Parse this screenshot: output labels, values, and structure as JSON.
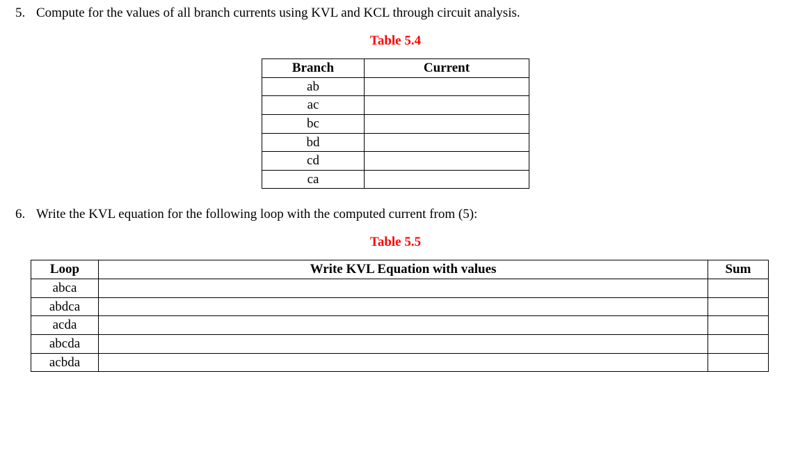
{
  "q5": {
    "number": "5.",
    "text": "Compute for the values of all branch currents using KVL and KCL through circuit analysis.",
    "caption": "Table 5.4",
    "headers": {
      "branch": "Branch",
      "current": "Current"
    },
    "rows": [
      {
        "branch": "ab",
        "current": ""
      },
      {
        "branch": "ac",
        "current": ""
      },
      {
        "branch": "bc",
        "current": ""
      },
      {
        "branch": "bd",
        "current": ""
      },
      {
        "branch": "cd",
        "current": ""
      },
      {
        "branch": "ca",
        "current": ""
      }
    ]
  },
  "q6": {
    "number": "6.",
    "text": "Write the KVL equation for the following loop with the computed current from (5):",
    "caption": "Table 5.5",
    "headers": {
      "loop": "Loop",
      "eq": "Write KVL Equation with values",
      "sum": "Sum"
    },
    "rows": [
      {
        "loop": "abca",
        "eq": "",
        "sum": ""
      },
      {
        "loop": "abdca",
        "eq": "",
        "sum": ""
      },
      {
        "loop": "acda",
        "eq": "",
        "sum": ""
      },
      {
        "loop": "abcda",
        "eq": "",
        "sum": ""
      },
      {
        "loop": "acbda",
        "eq": "",
        "sum": ""
      }
    ]
  }
}
